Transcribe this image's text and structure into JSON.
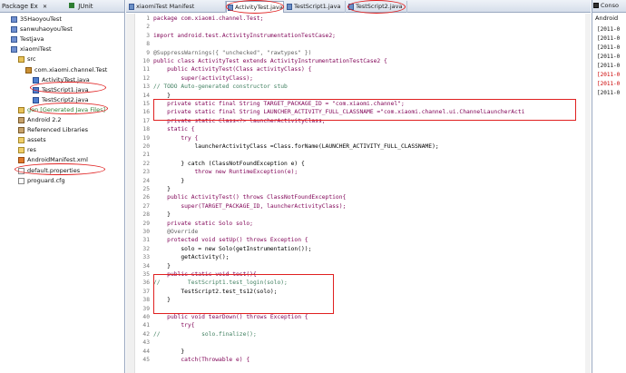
{
  "colors": {
    "accent": "#3a5a96",
    "annotation_red": "#e02020",
    "log_red": "#cc0000"
  },
  "left_panel": {
    "tabs": [
      {
        "label": "Package Ex"
      },
      {
        "label": "JUnit"
      }
    ],
    "tab_close": "✕",
    "tree": [
      {
        "label": "35HaoyouTest",
        "icon": "project-icon",
        "level": 0
      },
      {
        "label": "sanwuhaoyouTest",
        "icon": "project-icon",
        "level": 0
      },
      {
        "label": "Testjava",
        "icon": "project-icon",
        "level": 0
      },
      {
        "label": "xiaomiTest",
        "icon": "project-icon",
        "level": 0
      },
      {
        "label": "src",
        "icon": "source-folder-icon",
        "level": 1
      },
      {
        "label": "com.xiaomi.channel.Test",
        "icon": "package-icon",
        "level": 2
      },
      {
        "label": "ActivityTest.java",
        "icon": "java-file-icon",
        "level": 3
      },
      {
        "label": "TestScript1.java",
        "icon": "java-file-icon",
        "level": 3
      },
      {
        "label": "TestScript2.java",
        "icon": "java-file-icon",
        "level": 3
      },
      {
        "label": "gen [Generated Java Files]",
        "icon": "source-folder-icon",
        "level": 1,
        "color": "#2e7d32"
      },
      {
        "label": "Android 2.2",
        "icon": "library-icon",
        "level": 1
      },
      {
        "label": "Referenced Libraries",
        "icon": "library-icon",
        "level": 1
      },
      {
        "label": "assets",
        "icon": "folder-icon",
        "level": 1
      },
      {
        "label": "res",
        "icon": "folder-icon",
        "level": 1
      },
      {
        "label": "AndroidManifest.xml",
        "icon": "xml-file-icon",
        "level": 1
      },
      {
        "label": "default.properties",
        "icon": "file-icon",
        "level": 1
      },
      {
        "label": "proguard.cfg",
        "icon": "file-icon",
        "level": 1
      }
    ]
  },
  "editor": {
    "tabs": [
      {
        "label": "xiaomiTest Manifest"
      },
      {
        "label": "ActivityTest.java",
        "active": true
      },
      {
        "label": "TestScript1.java"
      },
      {
        "label": "TestScript2.java"
      }
    ],
    "lines": [
      {
        "num": "1",
        "text": "package com.xiaomi.channel.Test;"
      },
      {
        "num": "2",
        "text": ""
      },
      {
        "num": "3",
        "text": "import android.test.ActivityInstrumentationTestCase2;"
      },
      {
        "num": "8",
        "text": ""
      },
      {
        "num": "9",
        "text": "@SuppressWarnings({ \"unchecked\", \"rawtypes\" })"
      },
      {
        "num": "10",
        "text": "public class ActivityTest extends ActivityInstrumentationTestCase2 {"
      },
      {
        "num": "11",
        "text": "    public ActivityTest(Class activityClass) {"
      },
      {
        "num": "12",
        "text": "        super(activityClass);"
      },
      {
        "num": "13",
        "text": "// TODO Auto-generated constructor stub"
      },
      {
        "num": "14",
        "text": "    }"
      },
      {
        "num": "15",
        "text": "    private static final String TARGET_PACKAGE_ID = \"com.xiaomi.channel\";"
      },
      {
        "num": "16",
        "text": "    private static final String LAUNCHER_ACTIVITY_FULL_CLASSNAME =\"com.xiaomi.channel.ui.ChannelLauncherActi"
      },
      {
        "num": "17",
        "text": "    private static Class<?> launcherActivityClass;"
      },
      {
        "num": "18",
        "text": "    static {"
      },
      {
        "num": "19",
        "text": "        try {"
      },
      {
        "num": "20",
        "text": "            launcherActivityClass =Class.forName(LAUNCHER_ACTIVITY_FULL_CLASSNAME);"
      },
      {
        "num": "21",
        "text": ""
      },
      {
        "num": "22",
        "text": "        } catch (ClassNotFoundException e) {"
      },
      {
        "num": "23",
        "text": "            throw new RuntimeException(e);"
      },
      {
        "num": "24",
        "text": "        }"
      },
      {
        "num": "25",
        "text": "    }"
      },
      {
        "num": "26",
        "text": "    public ActivityTest() throws ClassNotFoundException{"
      },
      {
        "num": "27",
        "text": "        super(TARGET_PACKAGE_ID, launcherActivityClass);"
      },
      {
        "num": "28",
        "text": "    }"
      },
      {
        "num": "29",
        "text": "    private static Solo solo;"
      },
      {
        "num": "30",
        "text": "    @Override"
      },
      {
        "num": "31",
        "text": "    protected void setUp() throws Exception {"
      },
      {
        "num": "32",
        "text": "        solo = new Solo(getInstrumentation());"
      },
      {
        "num": "33",
        "text": "        getActivity();"
      },
      {
        "num": "34",
        "text": "    }"
      },
      {
        "num": "35",
        "text": "    public static void test(){"
      },
      {
        "num": "36",
        "text": "//        TestScript1.test_login(solo);"
      },
      {
        "num": "37",
        "text": "        TestScript2.test_ts12(solo);"
      },
      {
        "num": "38",
        "text": "    }"
      },
      {
        "num": "39",
        "text": ""
      },
      {
        "num": "40",
        "text": "    public void tearDown() throws Exception {"
      },
      {
        "num": "41",
        "text": "        try{"
      },
      {
        "num": "42",
        "text": "//            solo.finalize();"
      },
      {
        "num": "43",
        "text": ""
      },
      {
        "num": "44",
        "text": "        }"
      },
      {
        "num": "45",
        "text": "        catch(Throwable e) {"
      }
    ]
  },
  "right_panel": {
    "tab": "Conso",
    "subtitle": "Android",
    "log_lines": [
      {
        "text": "[2011-0",
        "red": false
      },
      {
        "text": "[2011-0",
        "red": false
      },
      {
        "text": "[2011-0",
        "red": false
      },
      {
        "text": "[2011-0",
        "red": false
      },
      {
        "text": "[2011-0",
        "red": false
      },
      {
        "text": "[2011-0",
        "red": true
      },
      {
        "text": "[2011-0",
        "red": true
      },
      {
        "text": "[2011-0",
        "red": false
      }
    ]
  }
}
